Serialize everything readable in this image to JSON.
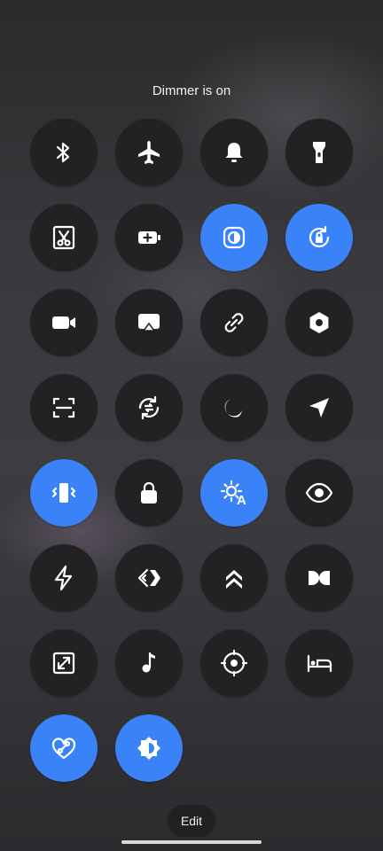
{
  "status_text": "Dimmer is on",
  "edit_label": "Edit",
  "accent_color": "#3a82f7",
  "tiles": [
    {
      "icon": "bluetooth-icon",
      "on": false
    },
    {
      "icon": "airplane-icon",
      "on": false
    },
    {
      "icon": "bell-icon",
      "on": false
    },
    {
      "icon": "flashlight-icon",
      "on": false
    },
    {
      "icon": "scissors-icon",
      "on": false
    },
    {
      "icon": "battery-saver-icon",
      "on": false
    },
    {
      "icon": "dark-mode-icon",
      "on": true
    },
    {
      "icon": "rotation-lock-icon",
      "on": true
    },
    {
      "icon": "video-camera-icon",
      "on": false
    },
    {
      "icon": "cast-screen-icon",
      "on": false
    },
    {
      "icon": "link-icon",
      "on": false
    },
    {
      "icon": "hexagon-settings-icon",
      "on": false
    },
    {
      "icon": "scan-icon",
      "on": false
    },
    {
      "icon": "data-sync-icon",
      "on": false
    },
    {
      "icon": "moon-icon",
      "on": false
    },
    {
      "icon": "location-arrow-icon",
      "on": false
    },
    {
      "icon": "vibrate-icon",
      "on": true
    },
    {
      "icon": "lock-icon",
      "on": false
    },
    {
      "icon": "auto-brightness-icon",
      "on": true
    },
    {
      "icon": "eye-icon",
      "on": false
    },
    {
      "icon": "lightning-icon",
      "on": false
    },
    {
      "icon": "code-diamond-icon",
      "on": false
    },
    {
      "icon": "double-chevron-up-icon",
      "on": false
    },
    {
      "icon": "dolby-icon",
      "on": false
    },
    {
      "icon": "screen-resize-icon",
      "on": false
    },
    {
      "icon": "music-note-icon",
      "on": false
    },
    {
      "icon": "target-icon",
      "on": false
    },
    {
      "icon": "bed-icon",
      "on": false
    },
    {
      "icon": "heart-link-icon",
      "on": true
    },
    {
      "icon": "brightness-icon",
      "on": true
    }
  ]
}
